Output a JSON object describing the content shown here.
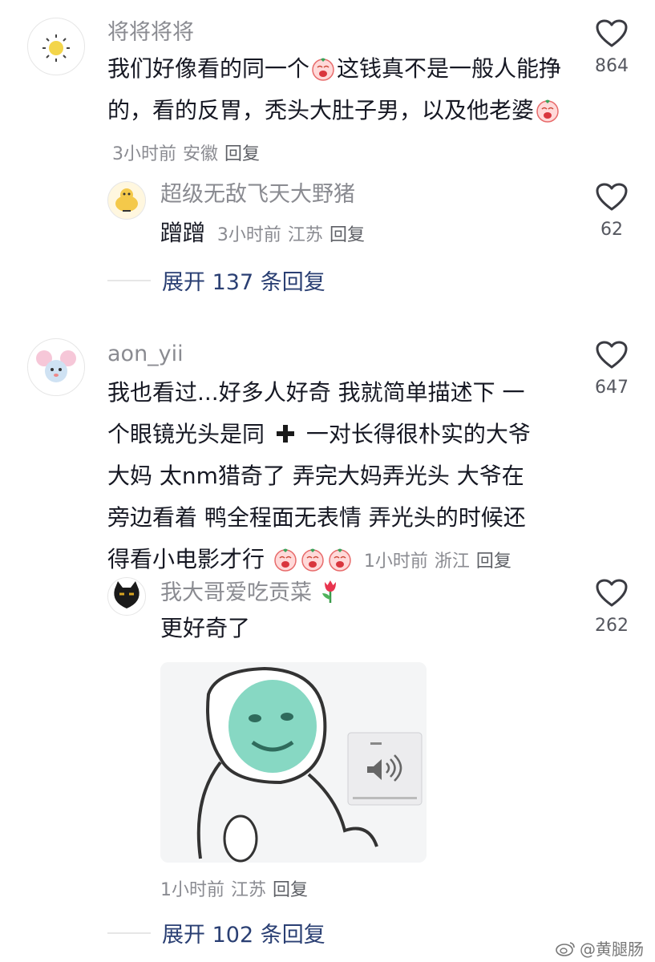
{
  "comments": [
    {
      "username": "将将将将",
      "text_parts": [
        "我们好像看的同一个",
        "这钱真不是一般人能挣的，看的反胃，秃头大肚子男，以及他老婆"
      ],
      "time": "3小时前",
      "location": "安徽",
      "reply_label": "回复",
      "likes": "864",
      "sub_reply": {
        "username": "超级无敌飞天大野猪",
        "text": "蹭蹭",
        "time": "3小时前",
        "location": "江苏",
        "reply_label": "回复",
        "likes": "62"
      },
      "expand_label": "展开 137 条回复"
    },
    {
      "username": "aon_yii",
      "text_lines": [
        "我也看过...好多人好奇 我就简单描述下 一",
        "个眼镜光头是同",
        "一对长得很朴实的大爷",
        "大妈 太nm猎奇了 弄完大妈弄光头 大爷在",
        "旁边看着 鸭全程面无表情 弄光头的时候还",
        "得看小电影才行"
      ],
      "time": "1小时前",
      "location": "浙江",
      "reply_label": "回复",
      "likes": "647",
      "sub_reply": {
        "username": "我大哥爱吃贡菜",
        "text": "更好奇了",
        "time": "1小时前",
        "location": "江苏",
        "reply_label": "回复",
        "likes": "262"
      },
      "expand_label": "展开 102 条回复"
    }
  ],
  "icons": {
    "like": "heart-outline-icon",
    "emoji": "crying-face-emoji",
    "cross": "heavy-plus-sign",
    "tulip": "tulip-emoji",
    "volume": "speaker-icon"
  },
  "watermark": "@黄腿肠",
  "colors": {
    "username": "#8a8b91",
    "text": "#161823",
    "expand": "#2a3f73",
    "meta": "#8a8b91"
  }
}
